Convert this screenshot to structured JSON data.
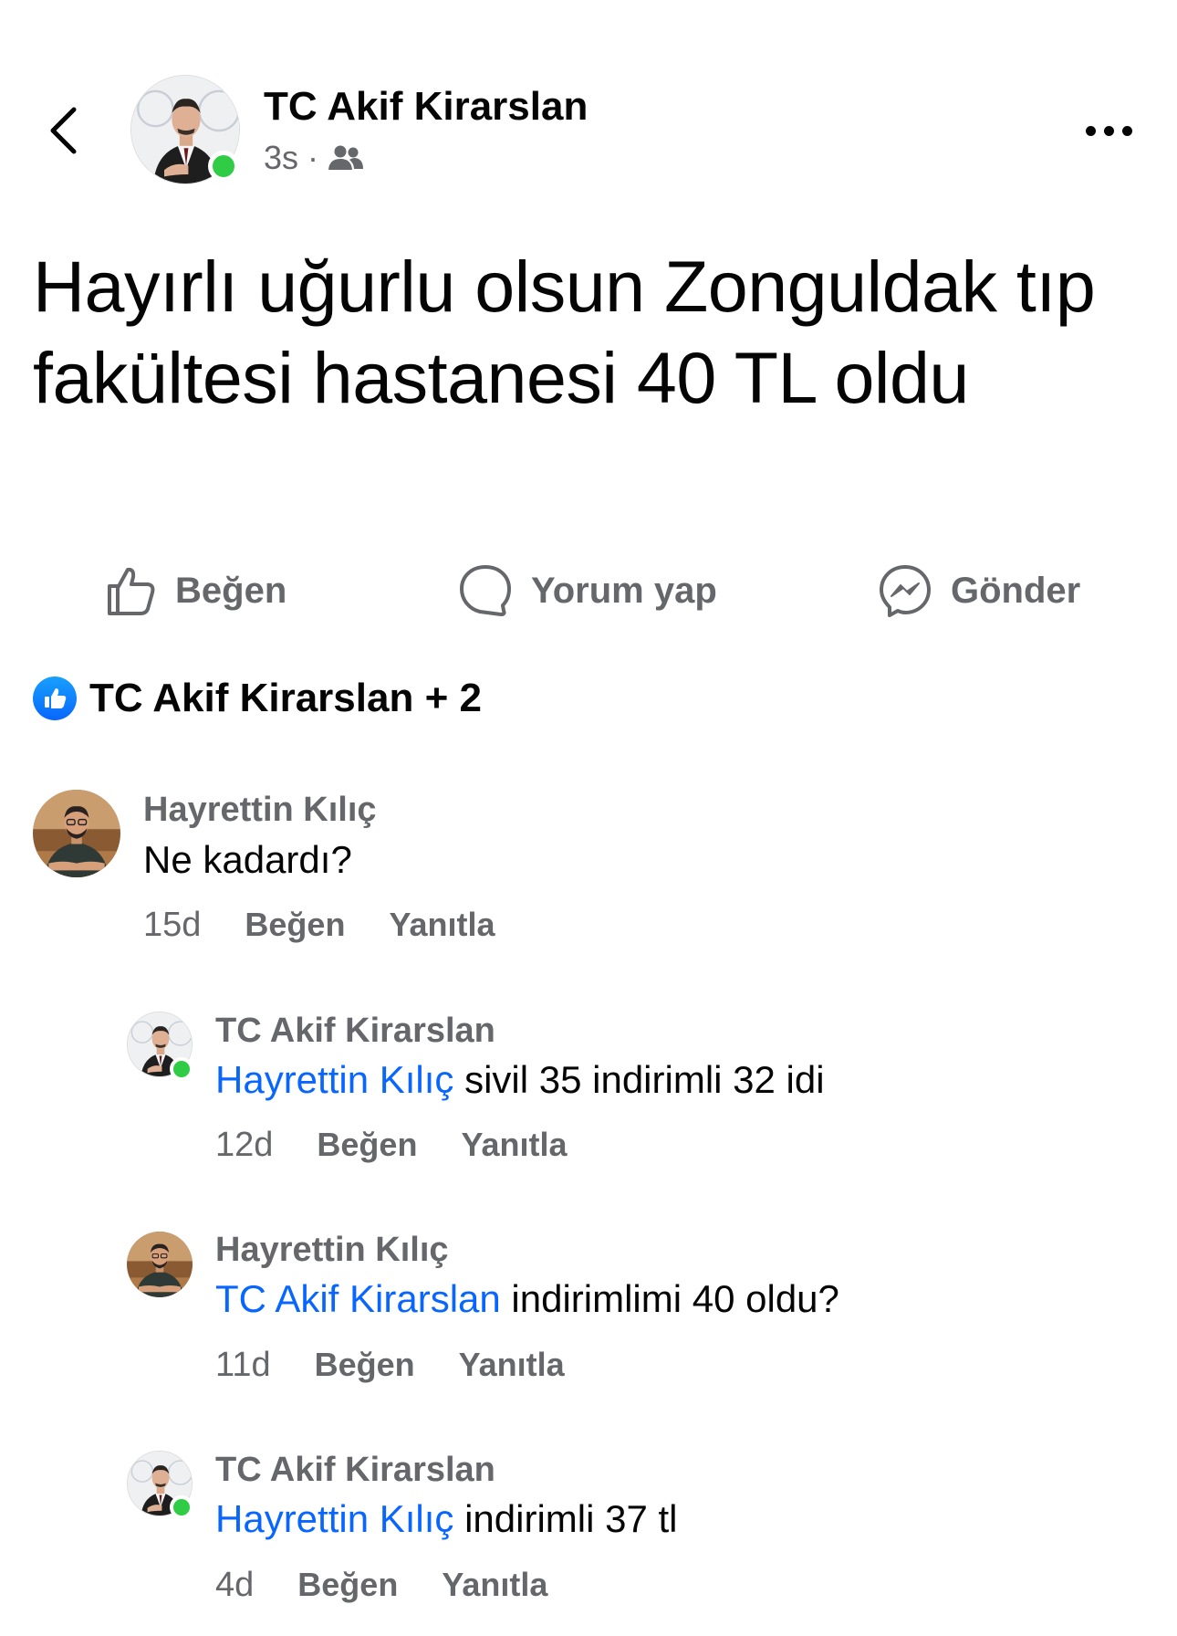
{
  "header": {
    "author_name": "TC Akif Kirarslan",
    "time": "3s",
    "separator": "·",
    "audience_icon": "friends-icon",
    "back_icon": "chevron-left-icon",
    "more_icon": "more-horizontal-icon"
  },
  "post": {
    "text": "Hayırlı uğurlu olsun Zonguldak tıp fakültesi hastanesi 40 TL oldu"
  },
  "actions": {
    "like_label": "Beğen",
    "comment_label": "Yorum yap",
    "send_label": "Gönder"
  },
  "reactions": {
    "summary": "TC Akif Kirarslan + 2"
  },
  "comments": [
    {
      "author": "Hayrettin Kılıç",
      "mention": "",
      "text": "Ne kadardı?",
      "time": "15d",
      "like_label": "Beğen",
      "reply_label": "Yanıtla"
    },
    {
      "author": "TC Akif Kirarslan",
      "mention": "Hayrettin Kılıç",
      "text": " sivil 35 indirimli 32 idi",
      "time": "12d",
      "like_label": "Beğen",
      "reply_label": "Yanıtla"
    },
    {
      "author": "Hayrettin Kılıç",
      "mention": "TC Akif Kirarslan",
      "text": " indirimlimi 40 oldu?",
      "time": "11d",
      "like_label": "Beğen",
      "reply_label": "Yanıtla"
    },
    {
      "author": "TC Akif Kirarslan",
      "mention": "Hayrettin Kılıç",
      "text": " indirimli 37 tl",
      "time": "4d",
      "like_label": "Beğen",
      "reply_label": "Yanıtla"
    }
  ],
  "colors": {
    "link": "#0866ff",
    "secondary_text": "#65676b",
    "online": "#31cc46"
  }
}
